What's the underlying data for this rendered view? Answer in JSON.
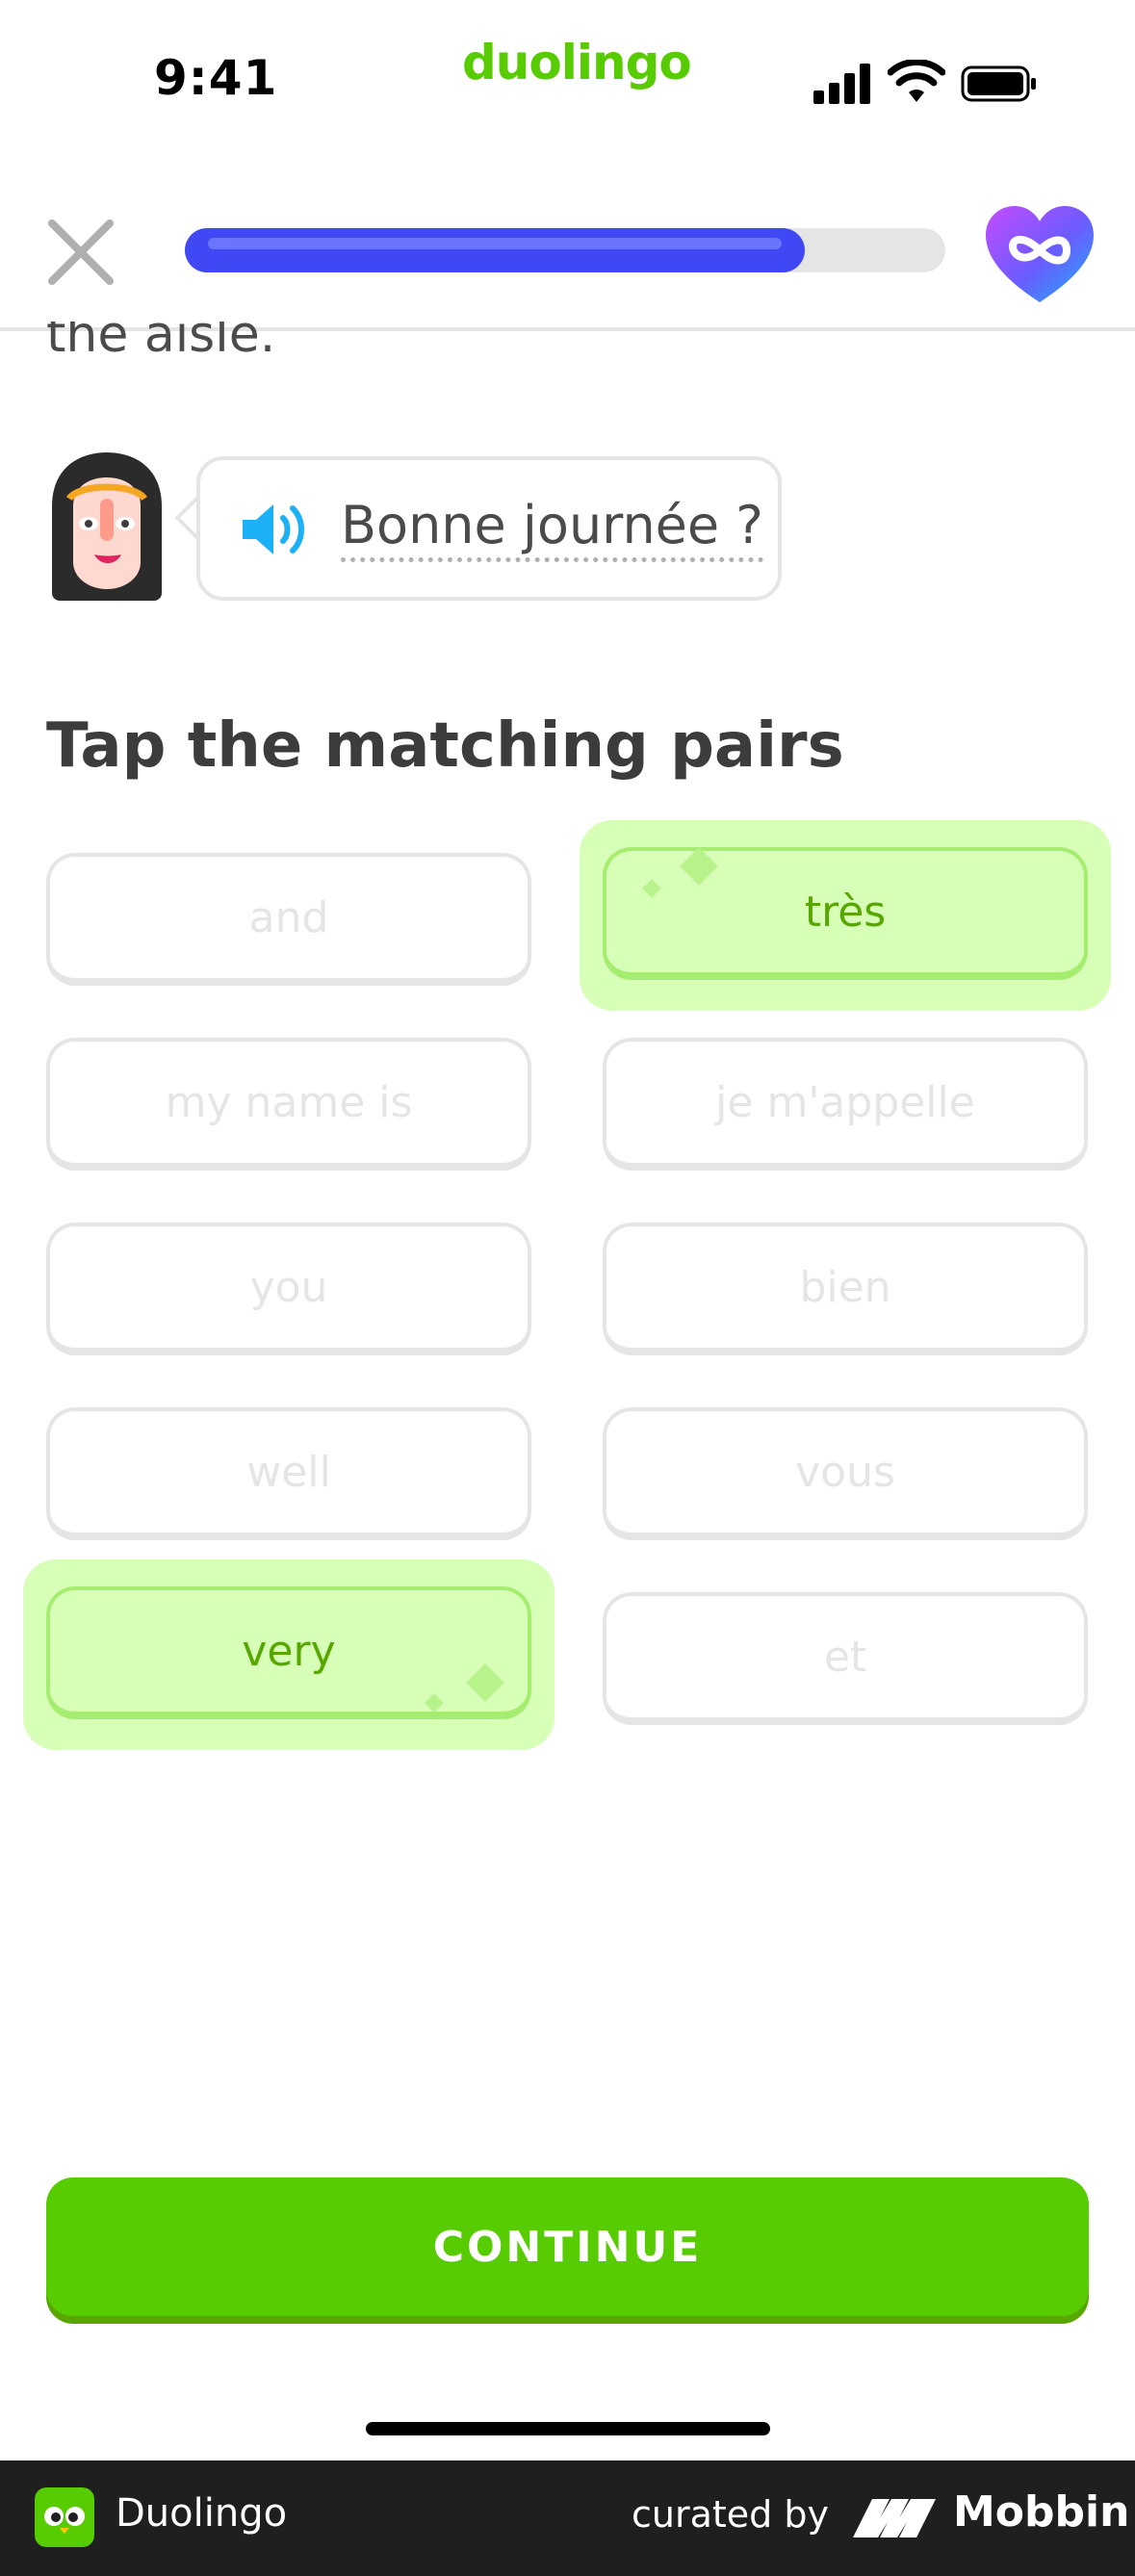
{
  "status_bar": {
    "time": "9:41",
    "brand": "duolingo"
  },
  "header": {
    "progress_fraction": 0.815
  },
  "prompt": {
    "cut_text": "the aisle.",
    "speech": "Bonne journée ?"
  },
  "exercise": {
    "title": "Tap the matching pairs",
    "left_tiles": [
      {
        "label": "and",
        "state": "done"
      },
      {
        "label": "my name is",
        "state": "done"
      },
      {
        "label": "you",
        "state": "done"
      },
      {
        "label": "well",
        "state": "done"
      },
      {
        "label": "very",
        "state": "correct"
      }
    ],
    "right_tiles": [
      {
        "label": "très",
        "state": "correct"
      },
      {
        "label": "je m'appelle",
        "state": "done"
      },
      {
        "label": "bien",
        "state": "done"
      },
      {
        "label": "vous",
        "state": "done"
      },
      {
        "label": "et",
        "state": "done"
      }
    ]
  },
  "actions": {
    "continue_label": "CONTINUE"
  },
  "footer": {
    "app_name": "Duolingo",
    "curated_by": "curated by",
    "brand": "Mobbin"
  },
  "colors": {
    "accent_green": "#58cc02",
    "progress_blue": "#4048f5",
    "match_bg": "#d7ffb8",
    "match_text": "#58a700"
  },
  "icons": [
    "close-icon",
    "infinity-heart-icon",
    "speaker-icon",
    "signal-icon",
    "wifi-icon",
    "battery-icon"
  ]
}
